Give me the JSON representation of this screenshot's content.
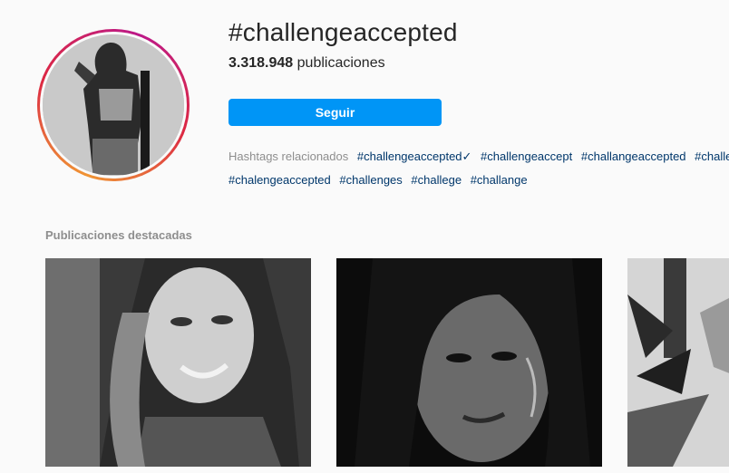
{
  "header": {
    "hashtag_title": "#challengeaccepted",
    "post_count": "3.318.948",
    "post_count_label": "publicaciones",
    "follow_label": "Seguir",
    "avatar": "profile-photo"
  },
  "related": {
    "label": "Hashtags relacionados",
    "row1": [
      "#challengeaccepted✓",
      "#challengeaccept",
      "#challangeaccepted",
      "#challe"
    ],
    "row2": [
      "#chalengeaccepted",
      "#challenges",
      "#challege",
      "#challange"
    ]
  },
  "featured": {
    "title": "Publicaciones destacadas",
    "posts": [
      "photo-woman-smiling",
      "photo-woman-closeup",
      "photo-plants"
    ]
  }
}
